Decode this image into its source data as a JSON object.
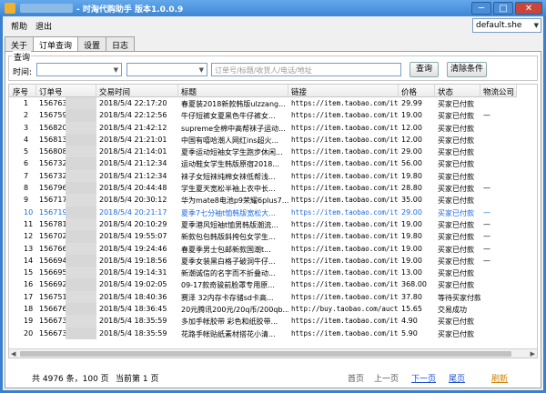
{
  "window": {
    "title": "- 时淘代购助手  版本1.0.0.9",
    "minimize": "─",
    "maximize": "□",
    "close": "✕"
  },
  "menu": {
    "help": "帮助",
    "exit": "退出"
  },
  "skin_select": {
    "value": "default.she"
  },
  "tabs": [
    {
      "label": "关于"
    },
    {
      "label": "订单查询"
    },
    {
      "label": "设置"
    },
    {
      "label": "日志"
    }
  ],
  "query": {
    "group_label": "查询",
    "time_label": "时间:",
    "search_placeholder": "订单号/标题/收货人/电话/地址",
    "search_button": "查询",
    "clear_button": "清除条件"
  },
  "table": {
    "columns": [
      "序号",
      "订单号",
      "交易时间",
      "标题",
      "链接",
      "价格",
      "状态",
      "物流公司"
    ],
    "rows": [
      {
        "num": "1",
        "order": "156763357",
        "time": "2018/5/4 22:17:20",
        "title": "春夏装2018新款韩版ulzzang...",
        "link": "https://item.taobao.com/item...",
        "price": "29.99",
        "status": "买家已付款",
        "logi": ""
      },
      {
        "num": "2",
        "order": "156759129",
        "time": "2018/5/4 22:12:56",
        "title": "牛仔短裤女夏黑色牛仔裤女...",
        "link": "https://item.taobao.com/item...",
        "price": "19.00",
        "status": "买家已付款",
        "logi": "—"
      },
      {
        "num": "3",
        "order": "156820028",
        "time": "2018/5/4 21:42:12",
        "title": "supreme全棉中高帮袜子运动...",
        "link": "https://item.taobao.com/item...",
        "price": "12.00",
        "status": "买家已付款",
        "logi": ""
      },
      {
        "num": "4",
        "order": "156813644",
        "time": "2018/5/4 21:21:01",
        "title": "中国有嘻哈潮人网红ins超火...",
        "link": "https://item.taobao.com/item...",
        "price": "12.00",
        "status": "买家已付款",
        "logi": ""
      },
      {
        "num": "5",
        "order": "156808520",
        "time": "2018/5/4 21:14:01",
        "title": "夏季运动短袖女学生跑步休闲...",
        "link": "https://item.taobao.com/item...",
        "price": "29.00",
        "status": "买家已付款",
        "logi": ""
      },
      {
        "num": "6",
        "order": "156732670",
        "time": "2018/5/4 21:12:34",
        "title": "运动鞋女学生韩版原宿2018...",
        "link": "https://item.taobao.com/item...",
        "price": "56.00",
        "status": "买家已付款",
        "logi": ""
      },
      {
        "num": "7",
        "order": "156732670",
        "time": "2018/5/4 21:12:34",
        "title": "袜子女短袜纯棉女袜低帮浅...",
        "link": "https://item.taobao.com/item...",
        "price": "19.80",
        "status": "买家已付款",
        "logi": ""
      },
      {
        "num": "8",
        "order": "156796004",
        "time": "2018/5/4 20:44:48",
        "title": "学生夏天宽松半袖上衣中长...",
        "link": "https://item.taobao.com/item...",
        "price": "28.80",
        "status": "买家已付款",
        "logi": "—"
      },
      {
        "num": "9",
        "order": "156717494",
        "time": "2018/5/4 20:30:12",
        "title": "华为mate8电池p9荣耀6plus7...",
        "link": "https://item.taobao.com/item...",
        "price": "35.00",
        "status": "买家已付款",
        "logi": ""
      },
      {
        "num": "10",
        "order": "156719567",
        "time": "2018/5/4 20:21:17",
        "title": "夏季7七分袖t恤韩版宽松大...",
        "link": "https://item.taobao.com/item...",
        "price": "29.00",
        "status": "买家已付款",
        "logi": "—"
      },
      {
        "num": "11",
        "order": "156781724",
        "time": "2018/5/4 20:10:29",
        "title": "夏季港风短袖t恤男韩版潮流...",
        "link": "https://item.taobao.com/item...",
        "price": "19.00",
        "status": "买家已付款",
        "logi": "—"
      },
      {
        "num": "12",
        "order": "156702878",
        "time": "2018/5/4 19:55:07",
        "title": "新款包包韩版斜挎包女学生...",
        "link": "https://item.taobao.com/item...",
        "price": "19.80",
        "status": "买家已付款",
        "logi": "—"
      },
      {
        "num": "13",
        "order": "156766184",
        "time": "2018/5/4 19:24:46",
        "title": "春夏季男士包邮新款国潮t...",
        "link": "https://item.taobao.com/item...",
        "price": "19.00",
        "status": "买家已付款",
        "logi": "—"
      },
      {
        "num": "14",
        "order": "156694674",
        "time": "2018/5/4 19:18:56",
        "title": "夏季女装黑白格子破洞牛仔...",
        "link": "https://item.taobao.com/item...",
        "price": "19.00",
        "status": "买家已付款",
        "logi": "—"
      },
      {
        "num": "15",
        "order": "156695518",
        "time": "2018/5/4 19:14:31",
        "title": "新潮诚信的名字而不折叠动...",
        "link": "https://item.taobao.com/item...",
        "price": "13.00",
        "status": "买家已付款",
        "logi": ""
      },
      {
        "num": "16",
        "order": "156692407",
        "time": "2018/5/4 19:02:05",
        "title": "09-17款奇骏前脸罩专用原...",
        "link": "https://item.taobao.com/item...",
        "price": "368.00",
        "status": "买家已付款",
        "logi": ""
      },
      {
        "num": "17",
        "order": "156751400",
        "time": "2018/5/4 18:40:36",
        "title": "赛泽 32内存卡存储sd卡高...",
        "link": "https://item.taobao.com/item...",
        "price": "37.80",
        "status": "等待买家付款",
        "logi": ""
      },
      {
        "num": "18",
        "order": "156676082",
        "time": "2018/5/4 18:36:45",
        "title": "20元腾讯200元/20q币/200qb...",
        "link": "http://buy.taobao.com/aucti...",
        "price": "15.65",
        "status": "交易成功",
        "logi": ""
      },
      {
        "num": "19",
        "order": "156673165",
        "time": "2018/5/4 18:35:59",
        "title": "多加手帐胶带 彩色和纸胶带...",
        "link": "https://item.taobao.com/item...",
        "price": "4.90",
        "status": "买家已付款",
        "logi": ""
      },
      {
        "num": "20",
        "order": "156673165",
        "time": "2018/5/4 18:35:59",
        "title": "花路手帐贴纸素材搭花小清...",
        "link": "https://item.taobao.com/item...",
        "price": "5.90",
        "status": "买家已付款",
        "logi": ""
      }
    ]
  },
  "pager": {
    "summary": "共 4976 条，100 页",
    "current": "当前第 1 页",
    "first": "首页",
    "prev": "上一页",
    "next": "下一页",
    "last": "尾页",
    "refresh": "刷新"
  },
  "colors": {
    "selected_row_text": "#1a6adf",
    "link_blue": "#1a4fd0",
    "refresh_orange": "#d08000"
  }
}
